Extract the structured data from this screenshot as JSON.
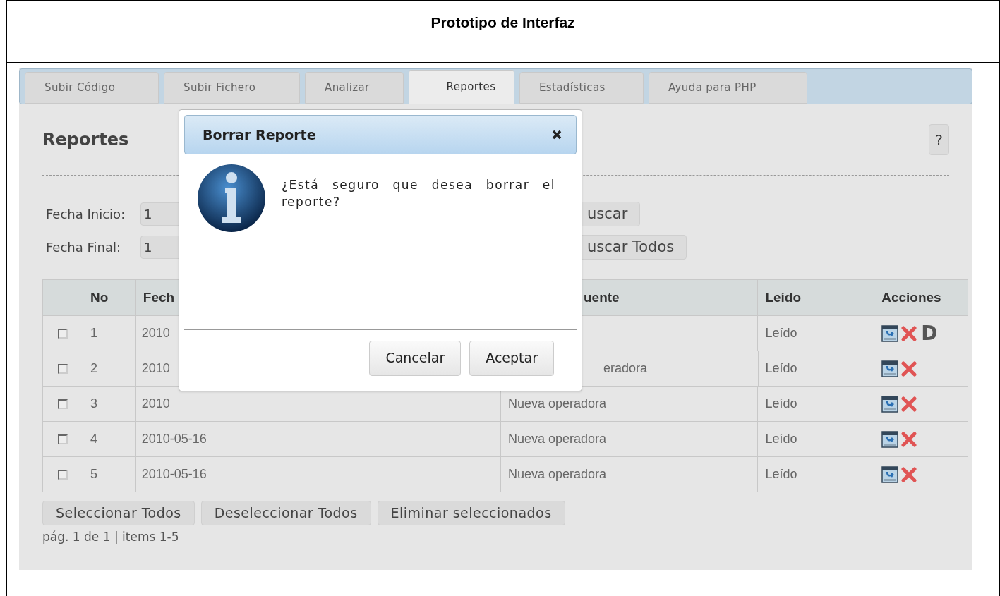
{
  "document_title": "Prototipo de Interfaz",
  "tabs": [
    {
      "label": "Subir Código",
      "selected": false
    },
    {
      "label": "Subir Fichero",
      "selected": false
    },
    {
      "label": "Analizar",
      "selected": false
    },
    {
      "label": "Reportes",
      "selected": true
    },
    {
      "label": "Estadísticas",
      "selected": false
    },
    {
      "label": "Ayuda para PHP",
      "selected": false
    }
  ],
  "page": {
    "heading": "Reportes",
    "help_button": "?"
  },
  "filters": [
    {
      "label": "Fecha Inicio:",
      "value": "1",
      "button": "uscar"
    },
    {
      "label": "Fecha Final:",
      "value": "1",
      "button": "uscar Todos"
    }
  ],
  "table": {
    "columns": [
      "No",
      "Fech",
      "uente",
      "Leído",
      "Acciones"
    ],
    "rows": [
      {
        "checked": false,
        "no": "1",
        "date": "2010",
        "read": "Leído",
        "extra": "D"
      },
      {
        "checked": false,
        "no": "2",
        "date": "2010",
        "source": "eradora",
        "read": "Leído"
      },
      {
        "checked": false,
        "no": "3",
        "date": "2010",
        "source": "Nueva operadora",
        "read": "Leído"
      },
      {
        "checked": false,
        "no": "4",
        "date": "2010-05-16",
        "source": "Nueva operadora",
        "read": "Leído"
      },
      {
        "checked": false,
        "no": "5",
        "date": "2010-05-16",
        "source": "Nueva operadora",
        "read": "Leído"
      }
    ]
  },
  "bottom_buttons": [
    "Seleccionar Todos",
    "Deseleccionar Todos",
    "Eliminar seleccionados"
  ],
  "pagination": "pág. 1 de 1 | items 1-5",
  "dialog": {
    "title": "Borrar Reporte",
    "message": "¿Está seguro que desea borrar el reporte?",
    "buttons": [
      "Cancelar",
      "Aceptar"
    ]
  }
}
